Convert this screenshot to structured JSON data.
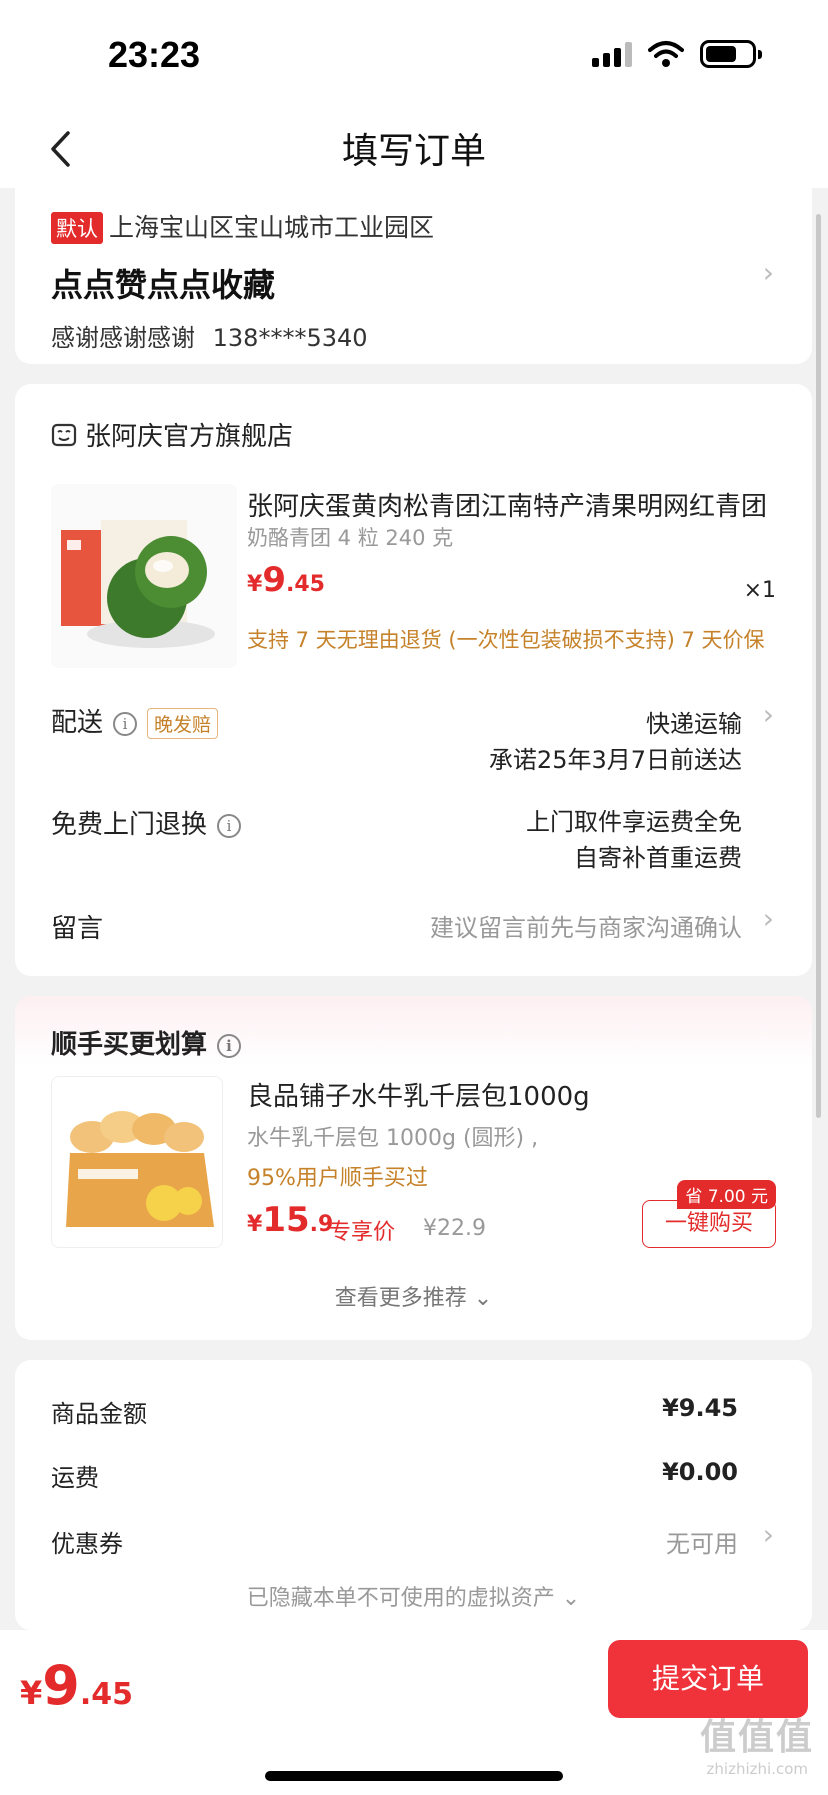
{
  "status_bar": {
    "time": "23:23"
  },
  "nav": {
    "title": "填写订单"
  },
  "address": {
    "default_tag": "默认",
    "region": "上海宝山区宝山城市工业园区",
    "detail": "点点赞点点收藏",
    "contact_name": "感谢感谢感谢",
    "phone": "138****5340"
  },
  "store": {
    "name": "张阿庆官方旗舰店"
  },
  "product": {
    "title": "张阿庆蛋黄肉松青团江南特产清果明网红青团",
    "spec": "奶酪青团 4 粒 240 克",
    "price_yen": "¥",
    "price_int": "9",
    "price_dec": ".45",
    "qty": "×1",
    "service": "支持 7 天无理由退货 (一次性包装破损不支持)  7 天价保"
  },
  "delivery": {
    "label": "配送",
    "badge": "晚发赔",
    "method": "快递运输",
    "promise": "承诺25年3月7日前送达"
  },
  "return_service": {
    "label": "免费上门退换",
    "line1": "上门取件享运费全免",
    "line2": "自寄补首重运费"
  },
  "message": {
    "label": "留言",
    "placeholder": "建议留言前先与商家沟通确认"
  },
  "recommend": {
    "title": "顺手买更划算",
    "name": "良品铺子水牛乳千层包1000g",
    "spec": "水牛乳千层包 1000g (圆形) ,",
    "bought": "95%用户顺手买过",
    "price_yen": "¥",
    "price_int": "15",
    "price_dec": ".9",
    "exclusive": "专享价",
    "original_price": "¥22.9",
    "save_tag": "省 7.00 元",
    "buy_button": "一键购买",
    "more": "查看更多推荐 ⌄"
  },
  "summary": {
    "goods_label": "商品金额",
    "goods_value": "¥9.45",
    "shipping_label": "运费",
    "shipping_value": "¥0.00",
    "coupon_label": "优惠券",
    "coupon_value": "无可用",
    "hidden_assets": "已隐藏本单不可使用的虚拟资产 ⌄"
  },
  "footer": {
    "total_yen": "¥",
    "total_int": "9",
    "total_dec": ".45",
    "submit": "提交订单",
    "watermark": "值值值",
    "watermark_sub": "zhizhizhi.com"
  },
  "colors": {
    "accent": "#e32b2b",
    "submit": "#f0333b",
    "service_text": "#c6822a"
  },
  "icons": [
    "back-arrow-icon",
    "signal-icon",
    "wifi-icon",
    "battery-icon",
    "store-icon",
    "info-icon",
    "chevron-right-icon"
  ]
}
